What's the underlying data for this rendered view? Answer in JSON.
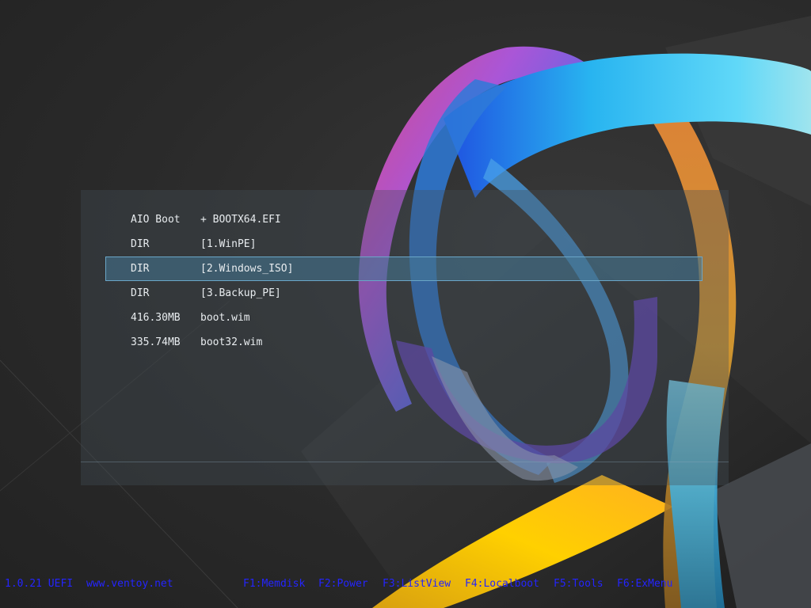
{
  "menu": {
    "items": [
      {
        "col_a": "AIO Boot",
        "col_b": "+ BOOTX64.EFI",
        "selected": false
      },
      {
        "col_a": "DIR",
        "col_b": "[1.WinPE]",
        "selected": false
      },
      {
        "col_a": "DIR",
        "col_b": "[2.Windows_ISO]",
        "selected": true
      },
      {
        "col_a": "DIR",
        "col_b": "[3.Backup_PE]",
        "selected": false
      },
      {
        "col_a": "416.30MB",
        "col_b": "boot.wim",
        "selected": false
      },
      {
        "col_a": "335.74MB",
        "col_b": "boot32.wim",
        "selected": false
      }
    ]
  },
  "footer": {
    "version": "1.0.21 UEFI",
    "website": "www.ventoy.net",
    "f1": "F1:Memdisk",
    "f2": "F2:Power",
    "f3": "F3:ListView",
    "f4": "F4:Localboot",
    "f5": "F5:Tools",
    "f6": "F6:ExMenu"
  },
  "colors": {
    "footer_text": "#2424ff",
    "menu_text": "#e8ecef",
    "selection_border": "#6aa6c8"
  }
}
